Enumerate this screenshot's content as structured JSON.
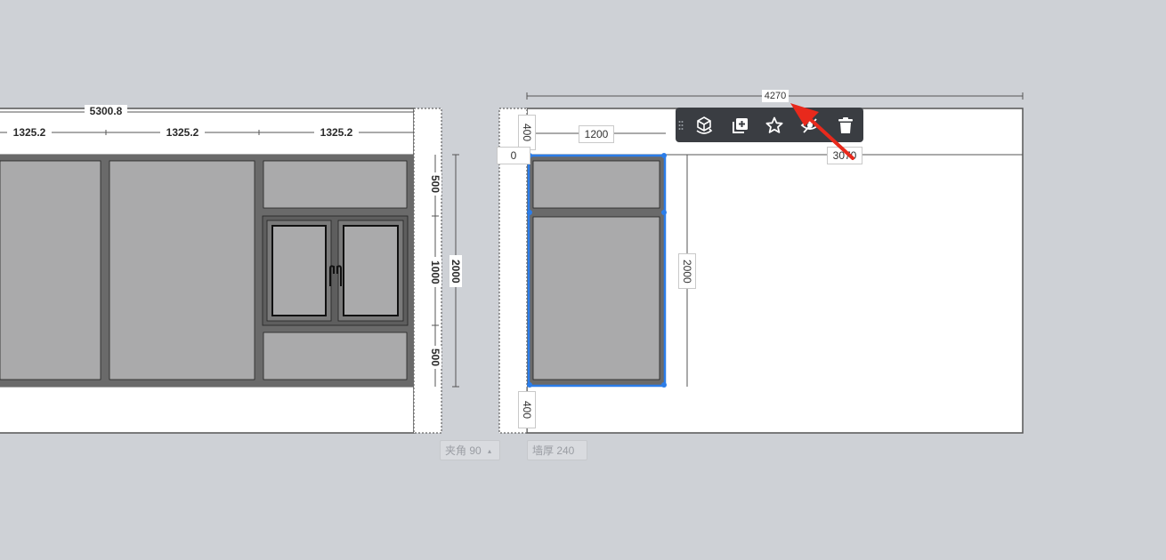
{
  "left_wall": {
    "total_width": "5300.8",
    "segments": [
      "1325.2",
      "1325.2",
      "1325.2"
    ],
    "vertical_dims": [
      "500",
      "1000",
      "500"
    ],
    "total_height": "2000"
  },
  "right_wall": {
    "total_width": "4270",
    "top_offset": "400",
    "bottom_offset": "400",
    "window_width": "1200",
    "left_offset": "0",
    "right_offset": "3070",
    "window_height": "2000"
  },
  "bottom_controls": {
    "angle_label": "夹角 90",
    "thickness_label": "墙厚 240"
  },
  "toolbar": {
    "buttons": [
      "rotate-3d-icon",
      "duplicate-icon",
      "star-icon",
      "hide-icon",
      "delete-icon"
    ]
  },
  "colors": {
    "background": "#ced1d6",
    "selection": "#2b7de9",
    "toolbar": "#3a3d42",
    "glass": "#aaaaab",
    "frame": "#6a6a6a",
    "arrow": "#e8291c"
  }
}
